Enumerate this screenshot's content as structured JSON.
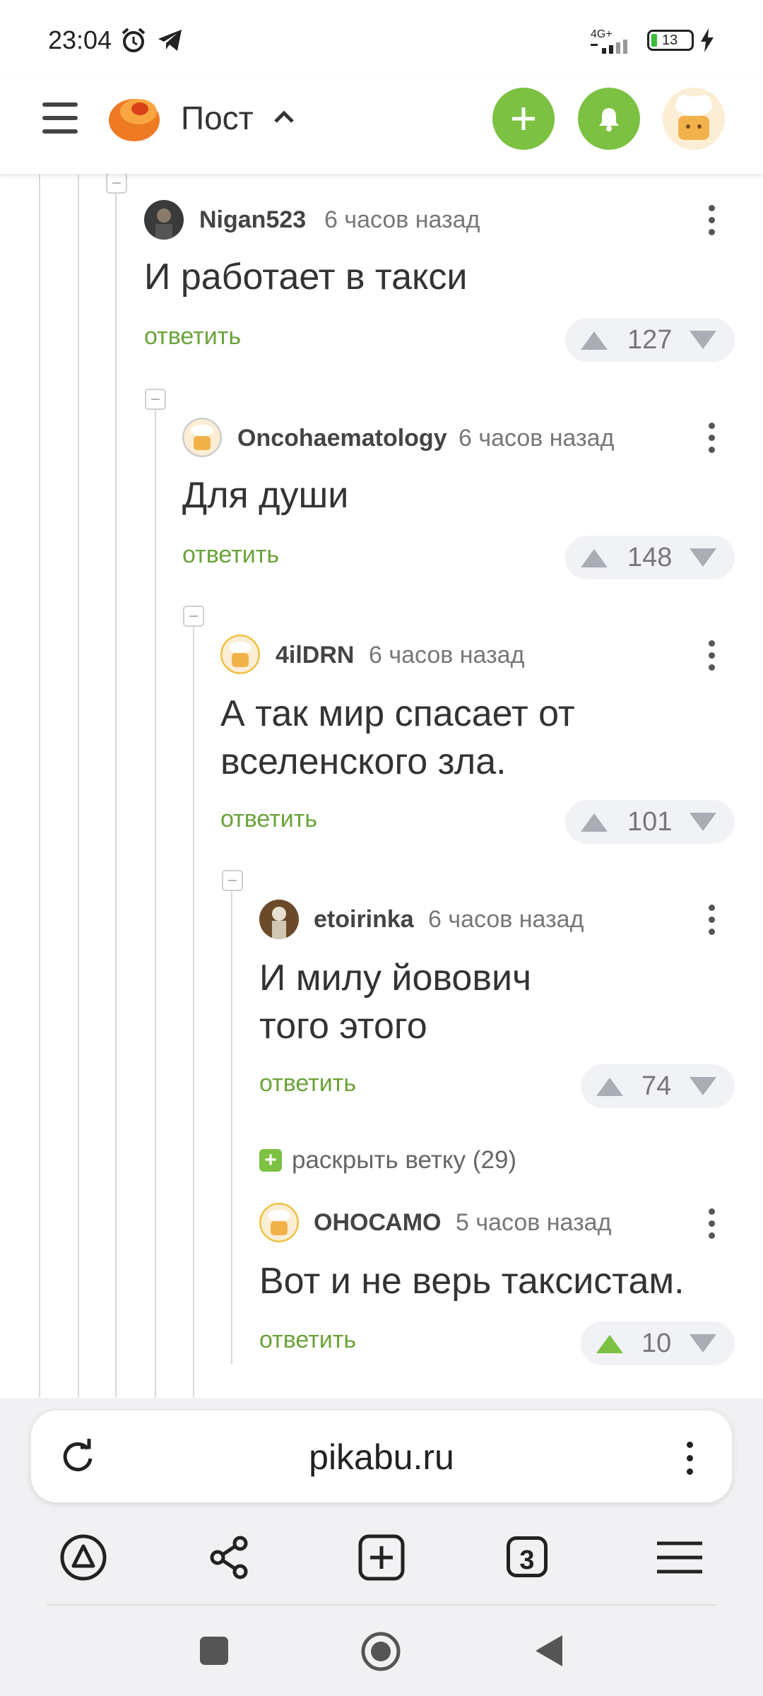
{
  "status": {
    "time": "23:04",
    "network": "4G+",
    "battery": "13"
  },
  "header": {
    "title": "Пост"
  },
  "comments": [
    {
      "author": "Nigan523",
      "time": "6 часов назад",
      "text": "И работает в такси",
      "reply": "ответить",
      "score": "127"
    },
    {
      "author": "Oncohaematology",
      "time": "6 часов назад",
      "text": "Для души",
      "reply": "ответить",
      "score": "148"
    },
    {
      "author": "4ilDRN",
      "time": "6 часов назад",
      "text_lines": [
        "А так мир спасает от",
        "вселенского зла."
      ],
      "reply": "ответить",
      "score": "101"
    },
    {
      "author": "etoirinka",
      "time": "6 часов назад",
      "text_lines": [
        "И милу йовович",
        "того этого"
      ],
      "reply": "ответить",
      "score": "74"
    },
    {
      "author": "ОНОСАМО",
      "time": "5 часов назад",
      "text": "Вот и не верь таксистам.",
      "reply": "ответить",
      "score": "10",
      "upvoted": true
    }
  ],
  "expand_branch": {
    "label": "раскрыть ветку (29)"
  },
  "browser": {
    "url": "pikabu.ru",
    "tab_count": "3"
  },
  "colors": {
    "accent": "#7cc142",
    "reply": "#6aa33a"
  },
  "icons": [
    "alarm-icon",
    "telegram-icon",
    "signal-icon",
    "battery-icon",
    "hamburger-icon",
    "pikabu-logo",
    "plus-icon",
    "bell-icon",
    "reload-icon",
    "alice-icon",
    "share-icon",
    "new-tab-icon",
    "tabs-icon",
    "menu-icon",
    "square-nav-icon",
    "home-nav-icon",
    "back-nav-icon"
  ]
}
